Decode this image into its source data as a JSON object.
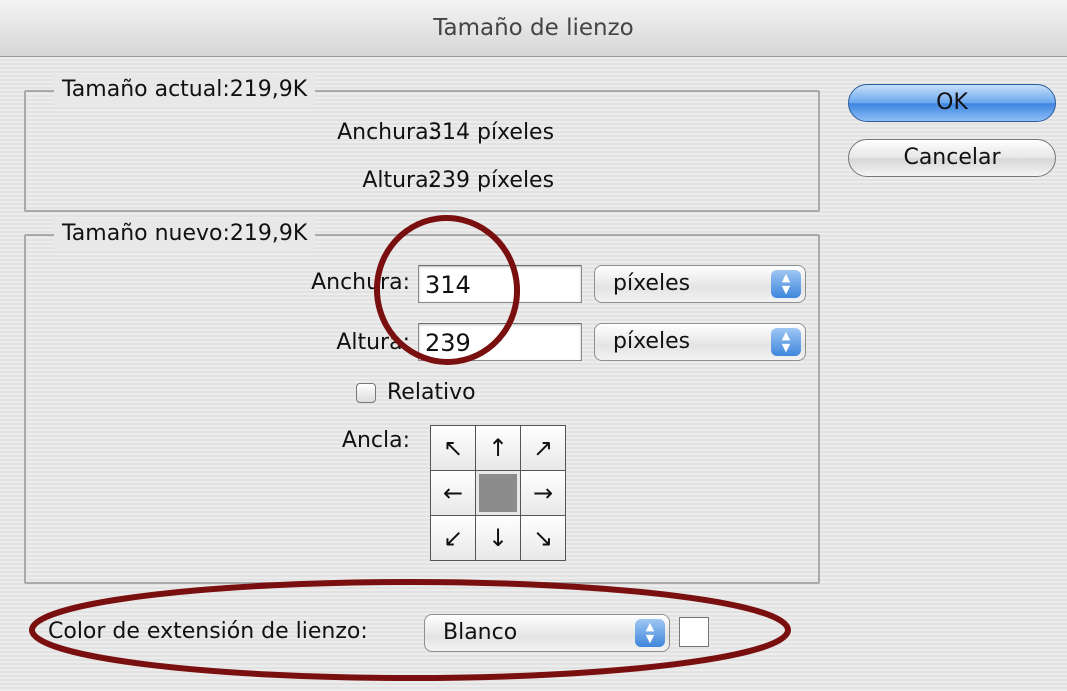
{
  "window": {
    "title": "Tamaño de lienzo"
  },
  "current_size": {
    "legend": "Tamaño actual:219,9K",
    "width_label": "Anchura:",
    "width_value": "314 píxeles",
    "height_label": "Altura:",
    "height_value": "239 píxeles"
  },
  "new_size": {
    "legend": "Tamaño nuevo:219,9K",
    "width_label": "Anchura:",
    "width_input": "314",
    "width_unit": "píxeles",
    "height_label": "Altura:",
    "height_input": "239",
    "height_unit": "píxeles",
    "relative_label": "Relativo",
    "relative_checked": false,
    "anchor_label": "Ancla:",
    "anchor_arrows": [
      "↖",
      "↑",
      "↗",
      "←",
      "",
      "→",
      "↙",
      "↓",
      "↘"
    ],
    "anchor_selected": "center"
  },
  "extension_color": {
    "label": "Color de extensión de lienzo:",
    "value": "Blanco",
    "swatch_color": "#ffffff"
  },
  "buttons": {
    "ok": "OK",
    "cancel": "Cancelar"
  },
  "colors": {
    "annotation": "#7a0f0f",
    "ok_button": "#5a9be8"
  }
}
